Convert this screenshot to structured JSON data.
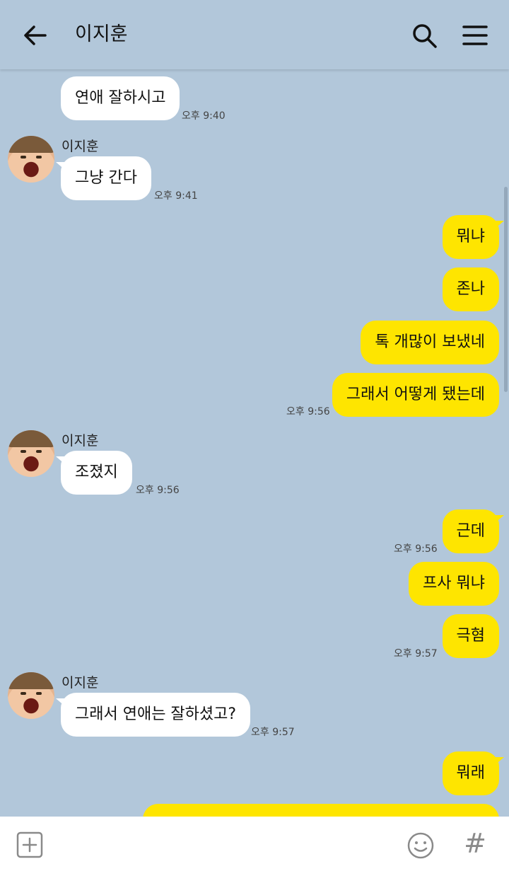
{
  "header": {
    "title": "이지훈"
  },
  "messages": [
    {
      "text": "연애 잘하시고",
      "time": "오후 9:40"
    },
    {
      "sender": "이지훈",
      "text": "그냥 간다",
      "time": "오후 9:41"
    },
    {
      "text": "뭐냐"
    },
    {
      "text": "존나"
    },
    {
      "text": "톡 개많이 보냈네"
    },
    {
      "text": "그래서 어떻게 됐는데",
      "time": "오후 9:56"
    },
    {
      "sender": "이지훈",
      "text": "조졌지",
      "time": "오후 9:56"
    },
    {
      "text": "근데",
      "time": "오후 9:56"
    },
    {
      "text": "프사 뭐냐"
    },
    {
      "text": "극혐",
      "time": "오후 9:57"
    },
    {
      "sender": "이지훈",
      "text": "그래서 연애는 잘하셨고?",
      "time": "오후 9:57"
    },
    {
      "text": "뭐래"
    }
  ],
  "footer": {
    "hash_label": "#"
  },
  "icons": {
    "back": "arrow-left-icon",
    "search": "search-icon",
    "menu": "hamburger-menu-icon",
    "add": "plus-square-icon",
    "emoji": "smile-icon"
  },
  "colors": {
    "background": "#b2c7da",
    "outgoing": "#fee500",
    "incoming": "#ffffff"
  }
}
